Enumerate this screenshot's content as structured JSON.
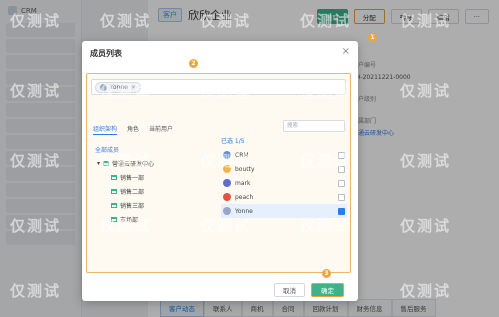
{
  "app": {
    "brand": "CRM"
  },
  "record": {
    "tag": "客户",
    "title": "欣欣企业",
    "actions": [
      "领取",
      "分配",
      "转移",
      "编辑",
      "···"
    ],
    "details": [
      {
        "label": "客户编号",
        "value": "KH-20211221-0000"
      },
      {
        "label": "客户级别",
        "value": ""
      },
      {
        "label": "所属部门",
        "value": "营通云研发中心"
      },
      {
        "label": "",
        "value": ""
      }
    ],
    "tabs": [
      "客户动态",
      "联系人",
      "商机",
      "合同",
      "回款计划",
      "财务信息",
      "售后服务"
    ],
    "active_tab": 0
  },
  "modal": {
    "title": "成员列表",
    "close": "×",
    "chip": "Yonne",
    "panel_tabs": [
      "组织架构",
      "角色",
      "当前用户"
    ],
    "search_placeholder": "搜索",
    "tree": [
      "全部成员",
      "营通云研发中心",
      "销售一部",
      "销售二部",
      "销售三部",
      "市场部"
    ],
    "selected_count": "已选 1/5",
    "members": [
      {
        "name": "CRM",
        "color": "#6b8fd6",
        "checked": false
      },
      {
        "name": "boutty",
        "color": "#f0b64a",
        "checked": false
      },
      {
        "name": "mark",
        "color": "#5c6ccf",
        "checked": false
      },
      {
        "name": "peach",
        "color": "#e0533f",
        "checked": false
      },
      {
        "name": "Yonne",
        "color": "#9ba4c9",
        "checked": true
      }
    ],
    "cancel": "取消",
    "ok": "确定"
  },
  "steps": [
    "1",
    "2",
    "3"
  ],
  "watermark": "仅测试"
}
